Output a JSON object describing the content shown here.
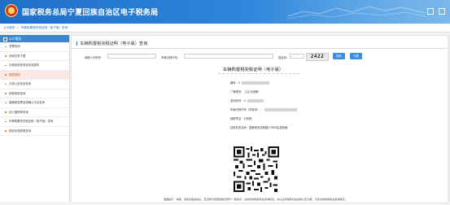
{
  "header": {
    "title": "国家税务总局宁夏回族自治区电子税务局"
  },
  "breadcrumb": {
    "items": [
      "公众服务",
      "车辆购置税完税证明（电子版）查询"
    ],
    "separator": ">"
  },
  "sidebar": {
    "heading": "公众服务",
    "items": [
      {
        "label": "发票查询",
        "active": false
      },
      {
        "label": "涉税记录下载",
        "active": false
      },
      {
        "label": "办税经验查询及信息服务",
        "active": false
      },
      {
        "label": "资质查询",
        "active": true
      },
      {
        "label": "欠税公告信息查询",
        "active": false
      },
      {
        "label": "纳税信用查询",
        "active": false
      },
      {
        "label": "增值税发票选择确认平台查询",
        "active": false
      },
      {
        "label": "出口退税率查询",
        "active": false
      },
      {
        "label": "车辆购置税完税证明（电子版）查询",
        "active": false
      },
      {
        "label": "税收优惠政策查询",
        "active": false
      }
    ]
  },
  "main": {
    "title": "车辆购置税完税证明（电子版）查询",
    "form": {
      "id_label": "纳税人识别号：",
      "vin_label": "车辆识别代号：",
      "captcha_label": "验证码：",
      "captcha_value": "2422",
      "query_button": "查询",
      "reset_button": "下载"
    }
  },
  "certificate": {
    "title": "车辆购置税完税证明（电子版）",
    "rows": [
      {
        "label": "编号：",
        "value": "5"
      },
      {
        "label": "厂牌型号：",
        "value": "长城牌"
      },
      {
        "label": "发动机号：",
        "value": "G"
      },
      {
        "label": "车辆识别代号（车架号）：",
        "value": ""
      },
      {
        "label": "纳税凭证：",
        "value": "已完税"
      },
      {
        "label": "征收机关名称：",
        "value": "国家税务总局银川市XX区税务局"
      }
    ]
  },
  "footnote": "温馨提示：本税、请核实相关信息，若出现与纸质完税证明不一致情况，请向当地税务机关咨询核实，并以主管税务机关最终认定为准，可至当地税务机关查询核实。",
  "colors": {
    "header_blue": "#2f86db",
    "sidebar_head": "#3d86cf",
    "accent_button": "#3a8ee6",
    "active_item": "#fde9e3"
  }
}
